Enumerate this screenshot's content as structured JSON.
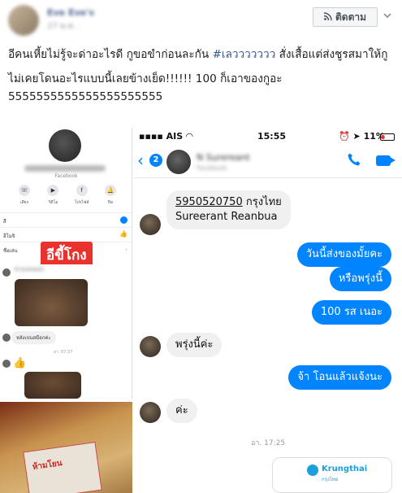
{
  "header": {
    "name": "Eve Eve's",
    "meta": "27 พ.ค. ·",
    "follow_label": "ติดตาม",
    "follow_icon": "rss-icon",
    "menu_icon": "chevron-down-icon"
  },
  "post": {
    "line1_pre": "อีคนเหี้ยไม่รู้จะด่าอะไรดี กูขอขำก่อนละกัน ",
    "hashtag": "#เลววววววว",
    "line1_post": " สั่งเสื้อแต่ส่งชูรสมาให้กู",
    "line2": "ไม่เคยโดนอะไรแบบนี้เลยข้างเย็ด!!!!!! 100 ก็เอาของกูอะ",
    "line3": "5555555555555555555555"
  },
  "left_image": {
    "profile_sub": "Facebook",
    "actions": [
      "เสียง",
      "วิดีโอ",
      "โปรไฟล์",
      "ปิด"
    ],
    "rows": [
      "สี",
      "อีโมจิ",
      "ชื่อเล่น"
    ],
    "stamp": "อีขี้โกง",
    "chat_name": "N Surereant",
    "chat_msg": "หลังเปนสมือกค่ะ",
    "chat_time": "อา. 07:37",
    "package_text": "ห้ามโยน"
  },
  "phone": {
    "carrier": "AIS",
    "time": "15:55",
    "battery": "11%",
    "back_count": "2",
    "contact_name": "N Surereant",
    "contact_sub": "Facebook",
    "messages": [
      {
        "dir": "in",
        "line1": "5950520750",
        "line1b": " กรุงไทย",
        "line2": "Sureerant Reanbua"
      },
      {
        "dir": "out",
        "text": "วันนี้ส่งของมั้ยคะ"
      },
      {
        "dir": "out",
        "text": "หรือพรุ่งนี้"
      },
      {
        "dir": "out",
        "text": "100 รส เนอะ"
      },
      {
        "dir": "in",
        "text": "พรุ่งนี้ค่ะ"
      },
      {
        "dir": "out",
        "text": "จ้า โอนแล้วแจ้งนะ"
      },
      {
        "dir": "in",
        "text": "ค่ะ"
      }
    ],
    "timestamp": "อา. 17:25",
    "bank_name": "Krungthai",
    "bank_sub": "กรุงไทย"
  }
}
